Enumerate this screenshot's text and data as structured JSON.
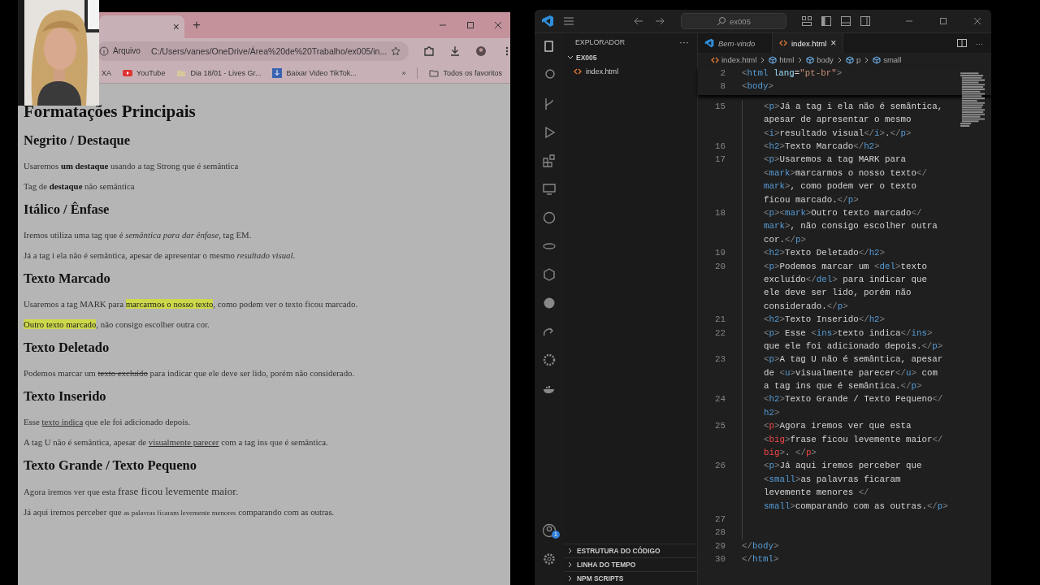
{
  "browser": {
    "tab": {
      "close": "×"
    },
    "new_tab": "+",
    "address": {
      "chip": "Arquivo",
      "url": "C:/Users/vanes/OneDrive/Área%20de%20Trabalho/ex005/in..."
    },
    "bookmarks": [
      {
        "label": "XA",
        "kind": "plain"
      },
      {
        "label": "YouTube",
        "kind": "youtube"
      },
      {
        "label": "Dia 18/01 - Lives Gr...",
        "kind": "folder"
      },
      {
        "label": "Baixar Video TikTok...",
        "kind": "download"
      }
    ],
    "bookmarks_more": "»",
    "all_bookmarks": "Todos os favoritos",
    "page": [
      {
        "kind": "h1",
        "segments": [
          {
            "kind": "plain",
            "text": "Formatações Principais"
          }
        ]
      },
      {
        "kind": "h2",
        "segments": [
          {
            "kind": "plain",
            "text": "Negrito / Destaque"
          }
        ]
      },
      {
        "kind": "p",
        "segments": [
          {
            "kind": "plain",
            "text": "Usaremos "
          },
          {
            "kind": "bold",
            "text": "um destaque"
          },
          {
            "kind": "plain",
            "text": " usando a tag Strong que é semântica"
          }
        ]
      },
      {
        "kind": "p",
        "segments": [
          {
            "kind": "plain",
            "text": "Tag de "
          },
          {
            "kind": "bold",
            "text": "destaque"
          },
          {
            "kind": "plain",
            "text": " não semântica"
          }
        ]
      },
      {
        "kind": "h2",
        "segments": [
          {
            "kind": "plain",
            "text": "Itálico / Ênfase"
          }
        ]
      },
      {
        "kind": "p",
        "segments": [
          {
            "kind": "plain",
            "text": "Iremos utiliza uma tag que é "
          },
          {
            "kind": "italic",
            "text": "semântica para dar ênfase"
          },
          {
            "kind": "plain",
            "text": ", tag EM."
          }
        ]
      },
      {
        "kind": "p",
        "segments": [
          {
            "kind": "plain",
            "text": "Já a tag i ela não é semântica, apesar de apresentar o mesmo "
          },
          {
            "kind": "italic",
            "text": "resultado visual"
          },
          {
            "kind": "plain",
            "text": "."
          }
        ]
      },
      {
        "kind": "h2",
        "segments": [
          {
            "kind": "plain",
            "text": "Texto Marcado"
          }
        ]
      },
      {
        "kind": "p",
        "segments": [
          {
            "kind": "plain",
            "text": "Usaremos a tag MARK para "
          },
          {
            "kind": "mark",
            "text": "marcarmos o nosso texto"
          },
          {
            "kind": "plain",
            "text": ", como podem ver o texto ficou marcado."
          }
        ]
      },
      {
        "kind": "p",
        "segments": [
          {
            "kind": "mark",
            "text": "Outro texto marcado"
          },
          {
            "kind": "plain",
            "text": ", não consigo escolher outra cor."
          }
        ]
      },
      {
        "kind": "h2",
        "segments": [
          {
            "kind": "plain",
            "text": "Texto Deletado"
          }
        ]
      },
      {
        "kind": "p",
        "segments": [
          {
            "kind": "plain",
            "text": "Podemos marcar um "
          },
          {
            "kind": "del",
            "text": "texto excluído"
          },
          {
            "kind": "plain",
            "text": " para indicar que ele deve ser lido, porém não considerado."
          }
        ]
      },
      {
        "kind": "h2",
        "segments": [
          {
            "kind": "plain",
            "text": "Texto Inserido"
          }
        ]
      },
      {
        "kind": "p",
        "segments": [
          {
            "kind": "plain",
            "text": "Esse "
          },
          {
            "kind": "underline",
            "text": "texto indica"
          },
          {
            "kind": "plain",
            "text": " que ele foi adicionado depois."
          }
        ]
      },
      {
        "kind": "p",
        "segments": [
          {
            "kind": "plain",
            "text": "A tag U não é semântica, apesar de "
          },
          {
            "kind": "underline",
            "text": "visualmente parecer"
          },
          {
            "kind": "plain",
            "text": " com a tag ins que é semântica."
          }
        ]
      },
      {
        "kind": "h2",
        "segments": [
          {
            "kind": "plain",
            "text": "Texto Grande / Texto Pequeno"
          }
        ]
      },
      {
        "kind": "p",
        "segments": [
          {
            "kind": "plain",
            "text": "Agora iremos ver que esta "
          },
          {
            "kind": "big",
            "text": "frase ficou levemente maior"
          },
          {
            "kind": "plain",
            "text": "."
          }
        ]
      },
      {
        "kind": "p",
        "segments": [
          {
            "kind": "plain",
            "text": "Já aqui iremos perceber que "
          },
          {
            "kind": "small",
            "text": "as palavras ficaram levemente menores"
          },
          {
            "kind": "plain",
            "text": " comparando com as outras."
          }
        ]
      }
    ]
  },
  "editor": {
    "search": "ex005",
    "sidebar": {
      "title": "EXPLORADOR",
      "more": "···",
      "folder": {
        "name": "EX005",
        "expanded": true,
        "files": [
          "index.html"
        ]
      },
      "panels": [
        "ESTRUTURA DO CÓDIGO",
        "LINHA DO TEMPO",
        "NPM SCRIPTS"
      ]
    },
    "account_badge": "1",
    "tabs": [
      {
        "label": "Bem-vindo",
        "kind": "welcome",
        "selected": false
      },
      {
        "label": "index.html",
        "kind": "html",
        "selected": true,
        "close": "×"
      }
    ],
    "breadcrumb": [
      "index.html",
      "html",
      "body",
      "p",
      "small"
    ],
    "sticky_lines": [
      {
        "number": "2",
        "rows": [
          "<html lang=\"pt-br\">"
        ]
      },
      {
        "number": "8",
        "rows": [
          "<body>"
        ]
      }
    ],
    "lines": [
      {
        "number": "15",
        "indented": true,
        "deprecated_tag": false,
        "rows": [
          "<p>Já a tag i ela não é semântica,",
          "apesar de apresentar o mesmo",
          "<i>resultado visual</i>.</p>"
        ]
      },
      {
        "number": "16",
        "indented": true,
        "deprecated_tag": false,
        "rows": [
          "<h2>Texto Marcado</h2>"
        ]
      },
      {
        "number": "17",
        "indented": true,
        "deprecated_tag": false,
        "rows": [
          "<p>Usaremos a tag MARK para",
          "<mark>marcarmos o nosso texto</",
          "mark>, como podem ver o texto",
          "ficou marcado.</p>"
        ]
      },
      {
        "number": "18",
        "indented": true,
        "deprecated_tag": false,
        "rows": [
          "<p><mark>Outro texto marcado</",
          "mark>, não consigo escolher outra",
          "cor.</p>"
        ]
      },
      {
        "number": "19",
        "indented": true,
        "deprecated_tag": false,
        "rows": [
          "<h2>Texto Deletado</h2>"
        ]
      },
      {
        "number": "20",
        "indented": true,
        "deprecated_tag": false,
        "rows": [
          "<p>Podemos marcar um <del>texto",
          "excluído</del> para indicar que",
          "ele deve ser lido, porém não",
          "considerado.</p>"
        ]
      },
      {
        "number": "21",
        "indented": true,
        "deprecated_tag": false,
        "rows": [
          "<h2>Texto Inserido</h2>"
        ]
      },
      {
        "number": "22",
        "indented": true,
        "deprecated_tag": false,
        "rows": [
          "<p> Esse <ins>texto indica</ins>",
          "que ele foi adicionado depois.</p>"
        ]
      },
      {
        "number": "23",
        "indented": true,
        "deprecated_tag": false,
        "rows": [
          "<p>A tag U não é semântica, apesar",
          "de <u>visualmente parecer</u> com",
          "a tag ins que é semântica.</p>"
        ]
      },
      {
        "number": "24",
        "indented": true,
        "deprecated_tag": false,
        "rows": [
          "<h2>Texto Grande / Texto Pequeno</",
          "h2>"
        ]
      },
      {
        "number": "25",
        "indented": true,
        "deprecated_tag": true,
        "rows": [
          "<p>Agora iremos ver que esta",
          "<big>frase ficou levemente maior</",
          "big>. </p>"
        ]
      },
      {
        "number": "26",
        "indented": true,
        "deprecated_tag": false,
        "rows": [
          "<p>Já aqui iremos perceber que",
          "<small>as palavras ficaram",
          "levemente menores </",
          "small>comparando com as outras.</p>"
        ]
      },
      {
        "number": "27",
        "indented": true
      },
      {
        "number": "28",
        "indented": true
      },
      {
        "number": "29",
        "rows": [
          "</body>"
        ]
      },
      {
        "number": "30",
        "rows": [
          "</html>"
        ]
      }
    ]
  }
}
